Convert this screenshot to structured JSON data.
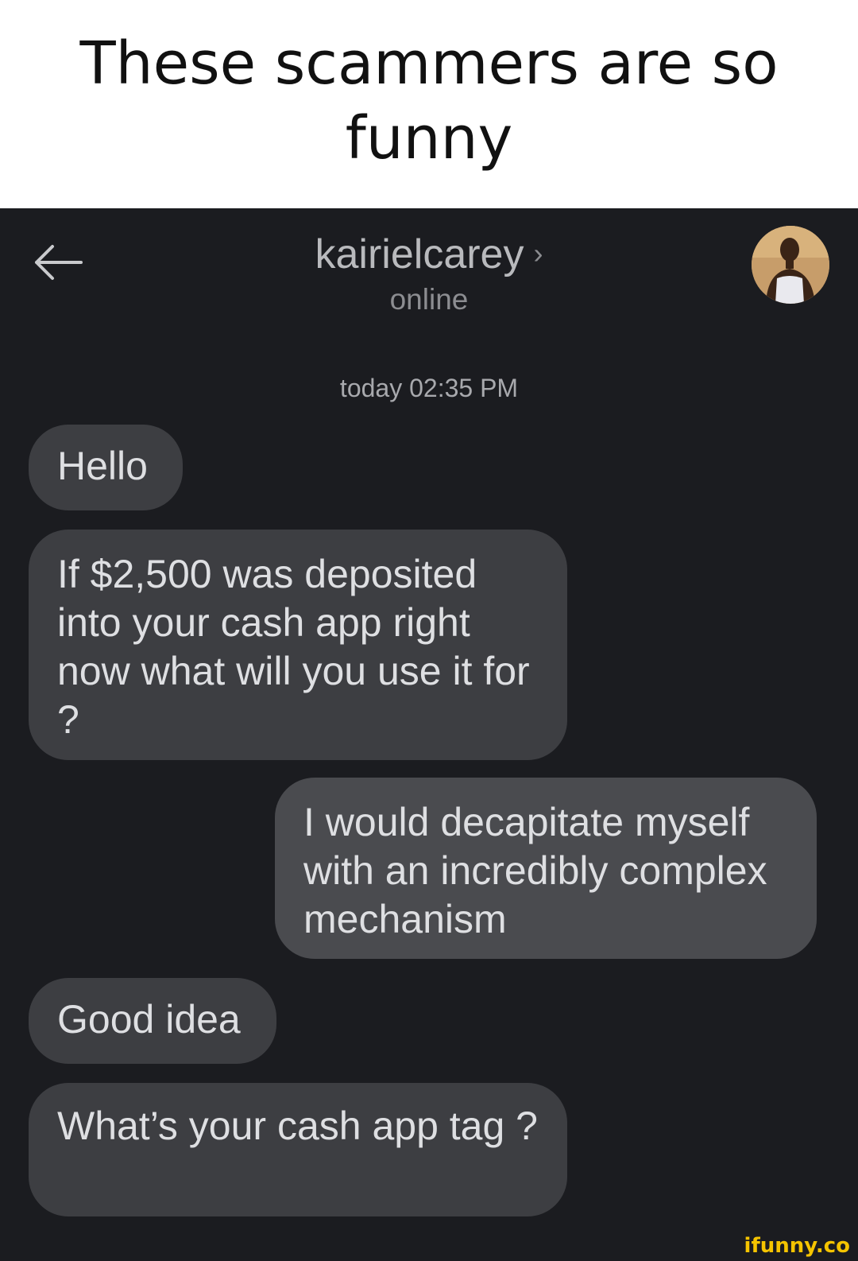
{
  "caption": {
    "text": "These scammers are so funny"
  },
  "header": {
    "contact_name": "kairielcarey",
    "chevron": "›",
    "status": "online",
    "back_icon": "arrow-left-icon",
    "avatar": "contact-avatar"
  },
  "conversation": {
    "timestamp": "today 02:35 PM",
    "messages": [
      {
        "direction": "incoming",
        "text": "Hello"
      },
      {
        "direction": "incoming",
        "text": "If $2,500 was deposited into your cash app right now what will you use it for ?"
      },
      {
        "direction": "outgoing",
        "text": "I would decapitate myself with an incredibly complex mechanism"
      },
      {
        "direction": "incoming",
        "text": "Good idea"
      },
      {
        "direction": "incoming",
        "text": "What’s your cash app tag ?"
      }
    ]
  },
  "watermark": {
    "text": "ifunny.co"
  },
  "colors": {
    "background": "#1b1c20",
    "incoming_bubble": "#3d3e42",
    "outgoing_bubble": "#4a4b4f",
    "watermark": "#f5c400"
  }
}
